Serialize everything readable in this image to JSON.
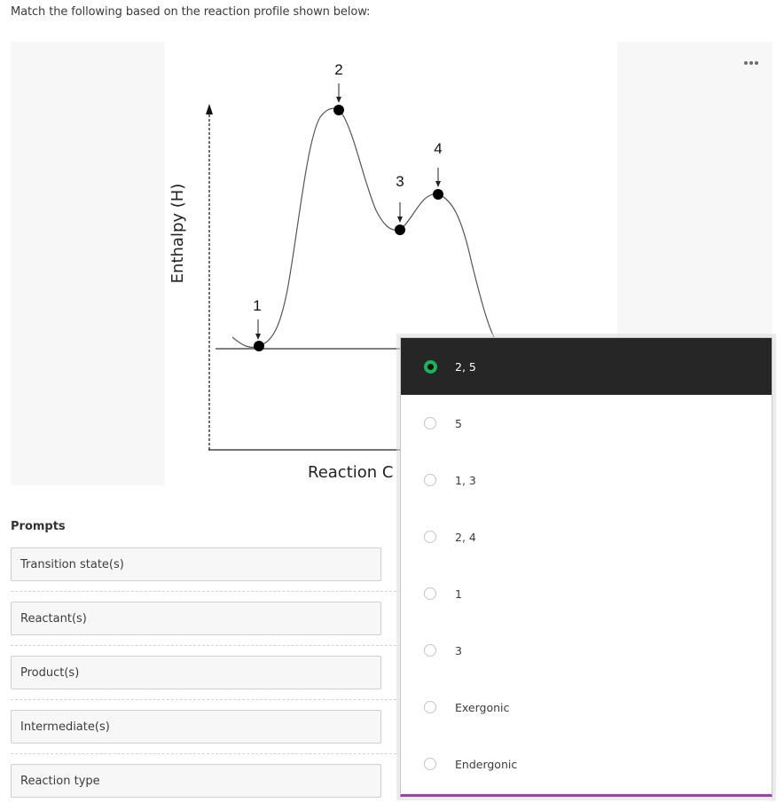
{
  "question": {
    "text": "Match the following based on the reaction profile shown below:"
  },
  "figure": {
    "y_axis_label": "Enthalpy (H)",
    "x_axis_label": "Reaction Coordinate",
    "x_axis_label_visible": "Reaction C",
    "points": [
      {
        "label": "1",
        "role": "start minimum"
      },
      {
        "label": "2",
        "role": "highest peak"
      },
      {
        "label": "3",
        "role": "valley between peaks"
      },
      {
        "label": "4",
        "role": "second peak"
      }
    ],
    "more_icon": "more-horizontal-icon"
  },
  "prompts": {
    "heading": "Prompts",
    "items": [
      {
        "label": "Transition state(s)"
      },
      {
        "label": "Reactant(s)"
      },
      {
        "label": "Product(s)"
      },
      {
        "label": "Intermediate(s)"
      },
      {
        "label": "Reaction type"
      }
    ]
  },
  "dropdown": {
    "selected": "2, 5",
    "options": [
      {
        "label": "2, 5",
        "selected": true
      },
      {
        "label": "5",
        "selected": false
      },
      {
        "label": "1, 3",
        "selected": false
      },
      {
        "label": "2, 4",
        "selected": false
      },
      {
        "label": "1",
        "selected": false
      },
      {
        "label": "3",
        "selected": false
      },
      {
        "label": "Exergonic",
        "selected": false
      },
      {
        "label": "Endergonic",
        "selected": false
      }
    ]
  },
  "colors": {
    "selected_bg": "#262626",
    "radio_selected": "#1bb35b",
    "focus_underline": "#a23bb5",
    "panel_bg": "#f7f7f7"
  }
}
